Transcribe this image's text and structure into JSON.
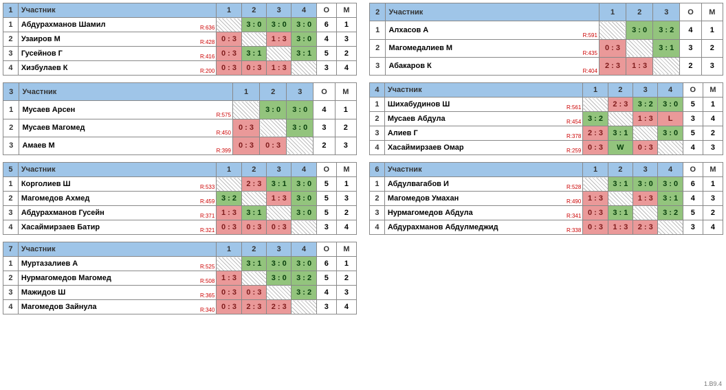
{
  "footer_version": "1.B9.4",
  "header_labels": {
    "participant": "Участник",
    "O": "О",
    "M": "М"
  },
  "groups": [
    {
      "num": 1,
      "size": 4,
      "players": [
        {
          "name": "Абдурахманов Шамил",
          "rating": "R:636",
          "scores": [
            "",
            "3 : 0",
            "3 : 0",
            "3 : 0"
          ],
          "O": 6,
          "M": 1
        },
        {
          "name": "Узаиров М",
          "rating": "R:428",
          "scores": [
            "0 : 3",
            "",
            "1 : 3",
            "3 : 0"
          ],
          "O": 4,
          "M": 3
        },
        {
          "name": "Гусейнов Г",
          "rating": "R:416",
          "scores": [
            "0 : 3",
            "3 : 1",
            "",
            "3 : 1"
          ],
          "O": 5,
          "M": 2
        },
        {
          "name": "Хизбулаев К",
          "rating": "R:200",
          "scores": [
            "0 : 3",
            "0 : 3",
            "1 : 3",
            ""
          ],
          "O": 3,
          "M": 4
        }
      ]
    },
    {
      "num": 2,
      "size": 3,
      "players": [
        {
          "name": "Алхасов А",
          "rating": "R:591",
          "scores": [
            "",
            "3 : 0",
            "3 : 2"
          ],
          "O": 4,
          "M": 1
        },
        {
          "name": "Магомедалиев М",
          "rating": "R:435",
          "scores": [
            "0 : 3",
            "",
            "3 : 1"
          ],
          "O": 3,
          "M": 2
        },
        {
          "name": "Абакаров К",
          "rating": "R:404",
          "scores": [
            "2 : 3",
            "1 : 3",
            ""
          ],
          "O": 2,
          "M": 3
        }
      ]
    },
    {
      "num": 3,
      "size": 3,
      "players": [
        {
          "name": "Мусаев Арсен",
          "rating": "R:575",
          "scores": [
            "",
            "3 : 0",
            "3 : 0"
          ],
          "O": 4,
          "M": 1
        },
        {
          "name": "Мусаев Магомед",
          "rating": "R:450",
          "scores": [
            "0 : 3",
            "",
            "3 : 0"
          ],
          "O": 3,
          "M": 2
        },
        {
          "name": "Амаев М",
          "rating": "R:399",
          "scores": [
            "0 : 3",
            "0 : 3",
            ""
          ],
          "O": 2,
          "M": 3
        }
      ]
    },
    {
      "num": 4,
      "size": 4,
      "players": [
        {
          "name": "Шихабудинов Ш",
          "rating": "R:561",
          "scores": [
            "",
            "2 : 3",
            "3 : 2",
            "3 : 0"
          ],
          "O": 5,
          "M": 1
        },
        {
          "name": "Мусаев Абдула",
          "rating": "R:454",
          "scores": [
            "3 : 2",
            "",
            "1 : 3",
            "L"
          ],
          "O": 3,
          "M": 4
        },
        {
          "name": "Алиев Г",
          "rating": "R:378",
          "scores": [
            "2 : 3",
            "3 : 1",
            "",
            "3 : 0"
          ],
          "O": 5,
          "M": 2
        },
        {
          "name": "Хасаймирзаев Омар",
          "rating": "R:259",
          "scores": [
            "0 : 3",
            "W",
            "0 : 3",
            ""
          ],
          "O": 4,
          "M": 3
        }
      ]
    },
    {
      "num": 5,
      "size": 4,
      "players": [
        {
          "name": "Корголиев Ш",
          "rating": "R:533",
          "scores": [
            "",
            "2 : 3",
            "3 : 1",
            "3 : 0"
          ],
          "O": 5,
          "M": 1
        },
        {
          "name": "Магомедов Ахмед",
          "rating": "R:459",
          "scores": [
            "3 : 2",
            "",
            "1 : 3",
            "3 : 0"
          ],
          "O": 5,
          "M": 3
        },
        {
          "name": "Абдурахманов Гусейн",
          "rating": "R:371",
          "scores": [
            "1 : 3",
            "3 : 1",
            "",
            "3 : 0"
          ],
          "O": 5,
          "M": 2
        },
        {
          "name": "Хасаймирзаев Батир",
          "rating": "R:321",
          "scores": [
            "0 : 3",
            "0 : 3",
            "0 : 3",
            ""
          ],
          "O": 3,
          "M": 4
        }
      ]
    },
    {
      "num": 6,
      "size": 4,
      "players": [
        {
          "name": "Абдулвагабов И",
          "rating": "R:528",
          "scores": [
            "",
            "3 : 1",
            "3 : 0",
            "3 : 0"
          ],
          "O": 6,
          "M": 1
        },
        {
          "name": "Магомедов Умахан",
          "rating": "R:490",
          "scores": [
            "1 : 3",
            "",
            "1 : 3",
            "3 : 1"
          ],
          "O": 4,
          "M": 3
        },
        {
          "name": "Нурмагомедов Абдула",
          "rating": "R:341",
          "scores": [
            "0 : 3",
            "3 : 1",
            "",
            "3 : 2"
          ],
          "O": 5,
          "M": 2
        },
        {
          "name": "Абдурахманов Абдулмеджид",
          "rating": "R:338",
          "scores": [
            "0 : 3",
            "1 : 3",
            "2 : 3",
            ""
          ],
          "O": 3,
          "M": 4
        }
      ]
    },
    {
      "num": 7,
      "size": 4,
      "players": [
        {
          "name": "Муртазалиев А",
          "rating": "R:525",
          "scores": [
            "",
            "3 : 1",
            "3 : 0",
            "3 : 0"
          ],
          "O": 6,
          "M": 1
        },
        {
          "name": "Нурмагомедов Магомед",
          "rating": "R:508",
          "scores": [
            "1 : 3",
            "",
            "3 : 0",
            "3 : 2"
          ],
          "O": 5,
          "M": 2
        },
        {
          "name": "Мажидов Ш",
          "rating": "R:365",
          "scores": [
            "0 : 3",
            "0 : 3",
            "",
            "3 : 2"
          ],
          "O": 4,
          "M": 3
        },
        {
          "name": "Магомедов Зайнула",
          "rating": "R:340",
          "scores": [
            "0 : 3",
            "2 : 3",
            "2 : 3",
            ""
          ],
          "O": 3,
          "M": 4
        }
      ]
    }
  ]
}
